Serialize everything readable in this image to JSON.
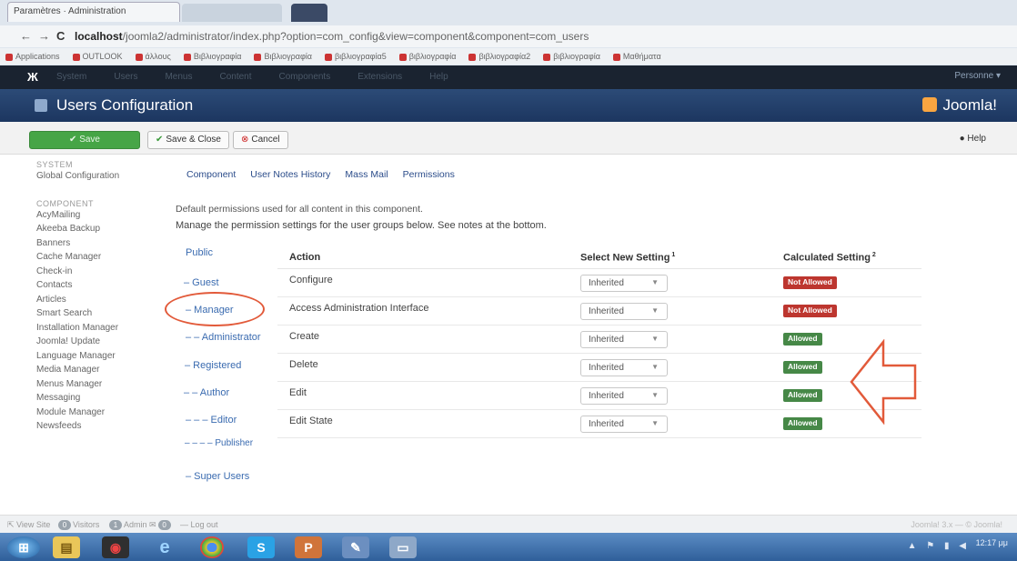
{
  "browser": {
    "tab_title": "Paramètres · Administration",
    "url_host": "localhost",
    "url_path": "/joomla2/administrator/index.php?option=com_config&view=component&component=com_users",
    "bookmarks": [
      "Applications",
      "OUTLOOK",
      "άλλους",
      "Βιβλιογραφία",
      "Βιβλιογραφία",
      "βιβλιογραφία5",
      "βιβλιογραφία",
      "βιβλιογραφία2",
      "βιβλιογραφία",
      "Μαθήματα"
    ]
  },
  "admin_menu": {
    "logo": "Ж",
    "items": [
      "System",
      "Users",
      "Menus",
      "Content",
      "Components",
      "Extensions",
      "Help"
    ],
    "user": "Personne ▾"
  },
  "header": {
    "title": "Users Configuration",
    "brand": "Joomla!"
  },
  "toolbar": {
    "save_label": "Save",
    "save_close_label": "Save & Close",
    "cancel_label": "Cancel",
    "help_label": "Help"
  },
  "sidebar": {
    "system_heading": "SYSTEM",
    "system_items": [
      "Global Configuration"
    ],
    "component_heading": "COMPONENT",
    "component_items": [
      "AcyMailing",
      "Akeeba Backup",
      "Banners",
      "Cache Manager",
      "Check-in",
      "Contacts",
      "Articles",
      "Smart Search",
      "Installation Manager",
      "Joomla! Update",
      "Language Manager",
      "Media Manager",
      "Menus Manager",
      "Messaging",
      "Module Manager",
      "Newsfeeds"
    ]
  },
  "tabs": [
    "Component",
    "User Notes History",
    "Mass Mail",
    "Permissions"
  ],
  "description": "Default permissions used for all content in this component.",
  "instructions": "Manage the permission settings for the user groups below. See notes at the bottom.",
  "groups": [
    "Public",
    "– Guest",
    "– Manager",
    "– – Administrator",
    "– Registered",
    "– – Author",
    "– – – Editor",
    "– – – – Publisher",
    "– Super Users"
  ],
  "table": {
    "headers": {
      "action": "Action",
      "new_setting": "Select New Setting",
      "calculated": "Calculated Setting"
    },
    "rows": [
      {
        "action": "Configure",
        "setting": "Inherited",
        "calculated": "Not Allowed"
      },
      {
        "action": "Access Administration Interface",
        "setting": "Inherited",
        "calculated": "Not Allowed"
      },
      {
        "action": "Create",
        "setting": "Inherited",
        "calculated": "Allowed"
      },
      {
        "action": "Delete",
        "setting": "Inherited",
        "calculated": "Allowed"
      },
      {
        "action": "Edit",
        "setting": "Inherited",
        "calculated": "Allowed"
      },
      {
        "action": "Edit State",
        "setting": "Inherited",
        "calculated": "Allowed"
      }
    ]
  },
  "statusbar": {
    "view_site": "View Site",
    "visitors_count": "0",
    "visitors_label": "Visitors",
    "admin_count": "1",
    "admin_label": "Admin",
    "messages_count": "0",
    "logout": "Log out",
    "right": "Joomla! 3.x — © Joomla!"
  },
  "taskbar": {
    "clock": "12:17 μμ"
  },
  "colors": {
    "header": "#2c4b77",
    "save": "#46a546",
    "not_allowed": "#bd362f",
    "allowed": "#468847",
    "annotation": "#e25a3a"
  }
}
